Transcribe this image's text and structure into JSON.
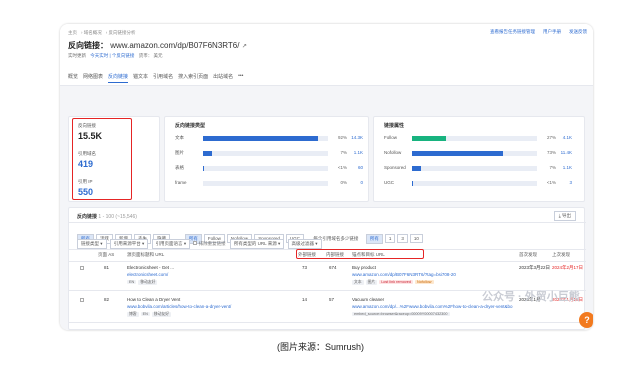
{
  "breadcrumb": [
    "主页",
    "域名概况",
    "反向链接分析"
  ],
  "top_actions": [
    "查看报告任务链接管理",
    "用户手册",
    "发送反馈"
  ],
  "title": {
    "label": "反向链接：",
    "url": "www.amazon.com/dp/B07F6N3RT6/"
  },
  "subline": {
    "label": "实时更新",
    "link": "今天实时 | 个反向链接",
    "db_label": "货币：",
    "db": "美元"
  },
  "tabs": [
    "概览",
    "网络图表",
    "反向链接",
    "锚文本",
    "引用域名",
    "搜入索引页面",
    "出站域名",
    "•••"
  ],
  "tabs_active": "反向链接",
  "metrics": [
    {
      "label": "反向链接",
      "value": "15.5K",
      "color": "#222"
    },
    {
      "label": "引用域名",
      "value": "419",
      "color": "#2d6bd0"
    },
    {
      "label": "引用 IP",
      "value": "550",
      "color": "#2d6bd0"
    }
  ],
  "types": {
    "title": "反向链接类型",
    "rows": [
      {
        "label": "文本",
        "pct": "92%",
        "count": "14.3K",
        "fill": 0.92,
        "color": "#2d6bd0"
      },
      {
        "label": "图片",
        "pct": "7%",
        "count": "1.1K",
        "fill": 0.07,
        "color": "#2d6bd0"
      },
      {
        "label": "表格",
        "pct": "<1%",
        "count": "60",
        "fill": 0.01,
        "color": "#2d6bd0"
      },
      {
        "label": "frame",
        "pct": "0%",
        "count": "0",
        "fill": 0,
        "color": "#2d6bd0"
      }
    ]
  },
  "attrs": {
    "title": "链接属性",
    "rows": [
      {
        "label": "Follow",
        "pct": "27%",
        "count": "4.1K",
        "fill": 0.27,
        "color": "#18b37f"
      },
      {
        "label": "Nofollow",
        "pct": "73%",
        "count": "11.4K",
        "fill": 0.73,
        "color": "#2d6bd0"
      },
      {
        "label": "Sponsored",
        "pct": "7%",
        "count": "1.1K",
        "fill": 0.07,
        "color": "#2d6bd0"
      },
      {
        "label": "UGC",
        "pct": "<1%",
        "count": "3",
        "fill": 0.01,
        "color": "#2d6bd0"
      }
    ]
  },
  "list": {
    "title": "反向链接",
    "range": "1 - 100 (~15,546)",
    "export": "导出"
  },
  "filters1": [
    "所有",
    "活跃",
    "新增",
    "丢失",
    "隐藏"
  ],
  "filters2": [
    "所有",
    "Follow",
    "Nofollow",
    "Sponsored",
    "UGC"
  ],
  "filters_label": "每个引用域名多少链接",
  "filters3": [
    "所有",
    "1",
    "3",
    "10"
  ],
  "filters_row2": [
    "链接类型",
    "引用来源平台",
    "引用页面语言",
    "排除重复链接",
    "所有类型的 URL 来源",
    "高级过滤器"
  ],
  "columns": [
    "页面 AS",
    "源页面标题和 URL",
    "外部链接",
    "内部链接",
    "锚点和目标 URL",
    "首次发现",
    "上次发现"
  ],
  "rows": [
    {
      "as": "81",
      "title": "Electronicsheet - Get ...",
      "url": "electronicsheet.com/",
      "tags": [
        "EN",
        "移动友好"
      ],
      "ext": "73",
      "int": "674",
      "anchor": "Buy product",
      "target": "www.amazon.com/dp/B07F6N3RT6/?tag=bsi708-20",
      "atags": [
        "文本",
        "图片",
        "Lost link removed",
        "Nofollow"
      ],
      "first": "2023年3月22日",
      "last": "2024年2月17日"
    },
    {
      "as": "82",
      "title": "How to Clean a Dryer Vent",
      "url": "www.bobvila.com/articles/how-to-clean-a-dryer-vent/",
      "tags": [
        "博客",
        "EN",
        "移动友好"
      ],
      "ext": "14",
      "int": "57",
      "anchor": "Vacuum cleaner",
      "target": "www.amazon.com/dp/...%2Fwww.bobvila.com%2Fhow-to-clean-a-dryer-vent&bo",
      "atags": [
        "embed_source=browser&raceup=00009Y00007432300"
      ],
      "first": "2023年1月",
      "last": "2024年1月19日"
    }
  ],
  "watermark": "公众号 · 外贸小巨熊",
  "fab": "?",
  "caption": "(图片来源：Sumrush)"
}
